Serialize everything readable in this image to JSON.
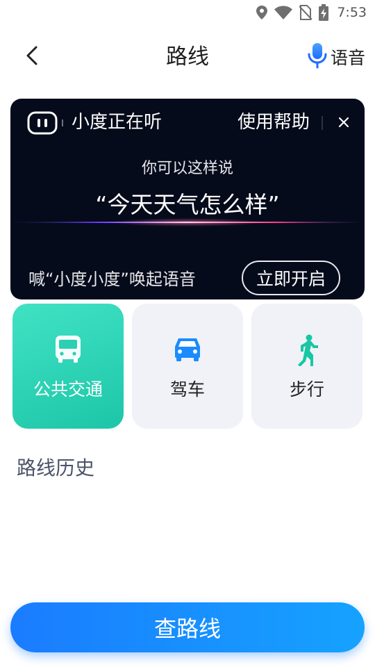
{
  "status_bar": {
    "time": "7:53",
    "icons": [
      "location-icon",
      "wifi-icon",
      "no-sim-icon",
      "battery-charging-icon"
    ]
  },
  "header": {
    "title": "路线",
    "back_icon": "back-arrow-icon",
    "voice_label": "语音",
    "voice_icon": "microphone-icon"
  },
  "voice_overlay": {
    "status": "小度正在听",
    "help": "使用帮助",
    "close_icon": "close-icon",
    "hint": "你可以这样说",
    "example": "“今天天气怎么样”",
    "wake_hint": "喊“小度小度”唤起语音",
    "enable_button": "立即开启"
  },
  "modes": [
    {
      "label": "公共交通",
      "icon": "bus-icon",
      "selected": true
    },
    {
      "label": "驾车",
      "icon": "car-icon",
      "selected": false
    },
    {
      "label": "步行",
      "icon": "walk-icon",
      "selected": false
    }
  ],
  "history_title": "路线历史",
  "search_button": "查路线",
  "colors": {
    "accent_teal": "#2dd3b5",
    "primary_blue": "#1a8cff",
    "overlay_bg": "#060b1b",
    "tile_bg": "#f0f2f7"
  }
}
